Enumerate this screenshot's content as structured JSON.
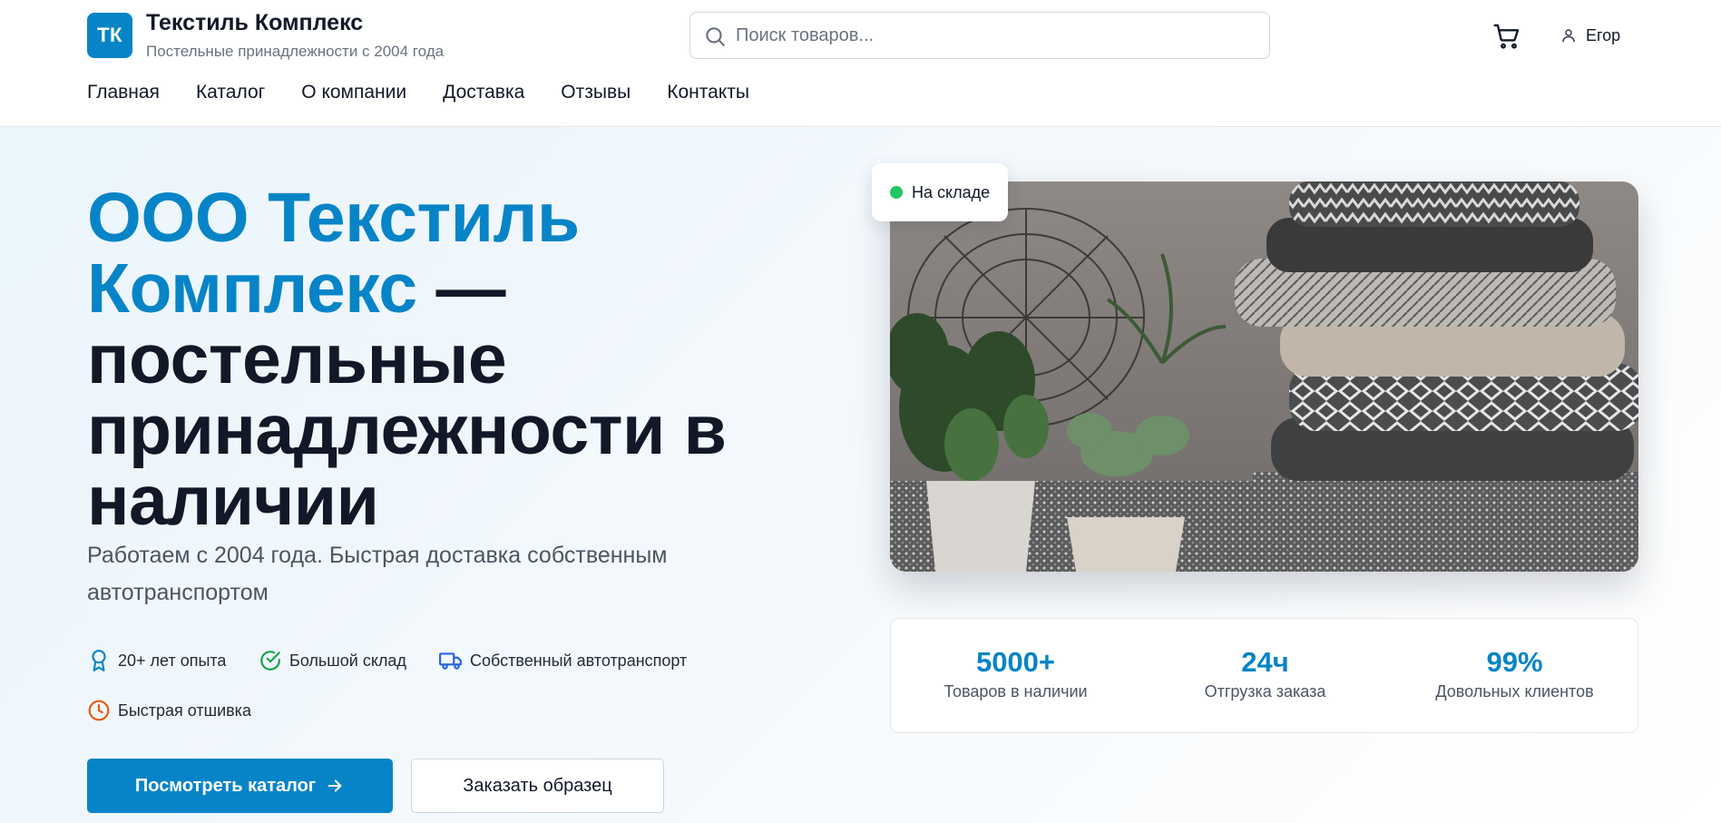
{
  "header": {
    "logo_text": "ТК",
    "brand_title": "Текстиль Комплекс",
    "brand_subtitle": "Постельные принадлежности с 2004 года",
    "search_placeholder": "Поиск товаров...",
    "user_name": "Егор"
  },
  "nav": {
    "items": [
      "Главная",
      "Каталог",
      "О компании",
      "Доставка",
      "Отзывы",
      "Контакты"
    ]
  },
  "hero": {
    "headline_accent": "ООО Текстиль Комплекс",
    "headline_rest": " — постельные принадлежности в наличии",
    "subtitle": "Работаем с 2004 года. Быстрая доставка собственным автотранспортом",
    "features": [
      {
        "icon": "award-icon",
        "label": "20+ лет опыта"
      },
      {
        "icon": "check-circle-icon",
        "label": "Большой склад"
      },
      {
        "icon": "truck-icon",
        "label": "Собственный автотранспорт"
      },
      {
        "icon": "clock-icon",
        "label": "Быстрая отшивка"
      }
    ],
    "primary_button": "Посмотреть каталог",
    "secondary_button": "Заказать образец",
    "stock_badge": "На складе",
    "stats": [
      {
        "value": "5000+",
        "label": "Товаров в наличии"
      },
      {
        "value": "24ч",
        "label": "Отгрузка заказа"
      },
      {
        "value": "99%",
        "label": "Довольных клиентов"
      }
    ]
  },
  "colors": {
    "accent": "#0784c7",
    "text": "#111827",
    "muted": "#6b7280",
    "success": "#22c55e",
    "warning": "#ea580c",
    "success_check": "#16a34a"
  }
}
